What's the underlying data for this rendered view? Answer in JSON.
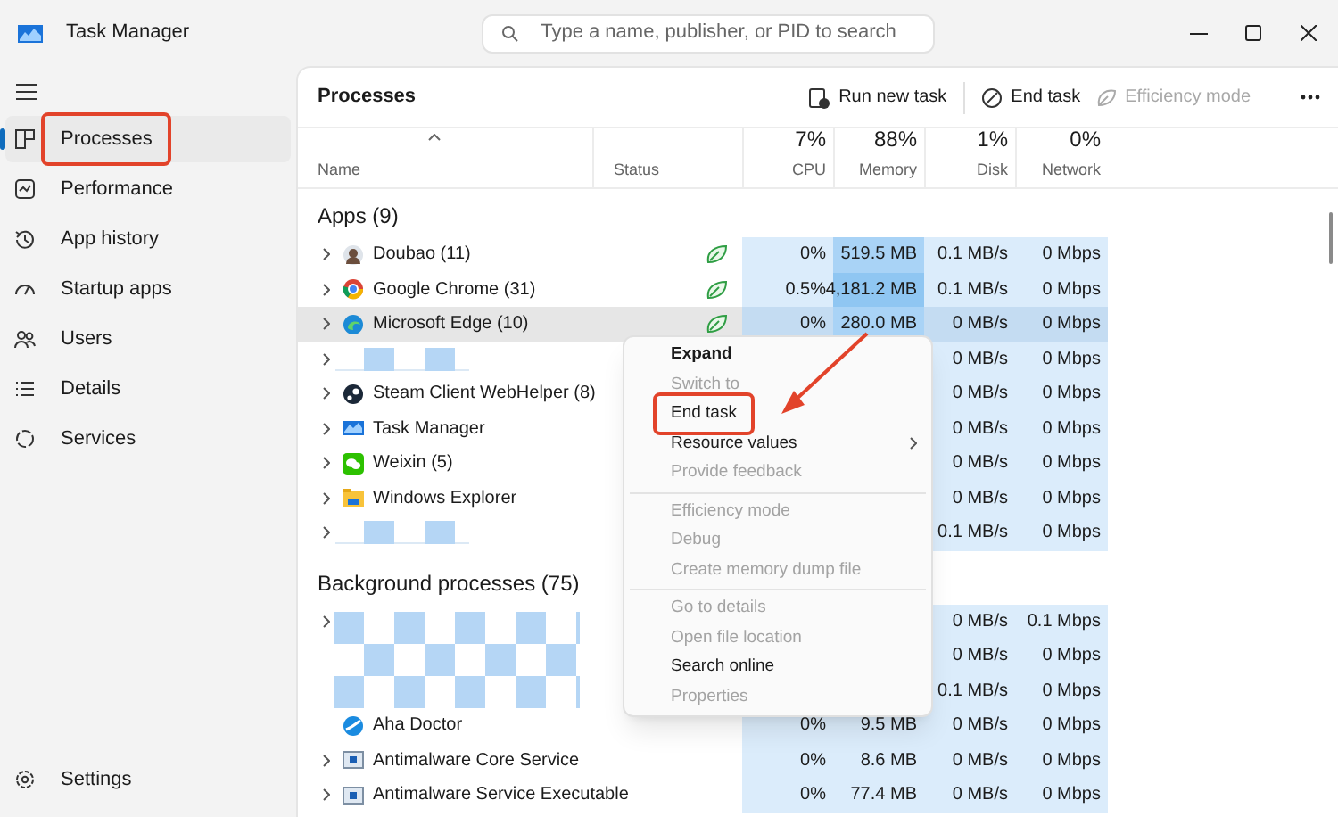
{
  "window": {
    "title": "Task Manager"
  },
  "search": {
    "placeholder": "Type a name, publisher, or PID to search"
  },
  "sidebar": {
    "items": [
      {
        "label": "Processes",
        "selected": true,
        "highlighted": true
      },
      {
        "label": "Performance",
        "selected": false,
        "highlighted": false
      },
      {
        "label": "App history",
        "selected": false,
        "highlighted": false
      },
      {
        "label": "Startup apps",
        "selected": false,
        "highlighted": false
      },
      {
        "label": "Users",
        "selected": false,
        "highlighted": false
      },
      {
        "label": "Details",
        "selected": false,
        "highlighted": false
      },
      {
        "label": "Services",
        "selected": false,
        "highlighted": false
      }
    ],
    "footer": {
      "label": "Settings"
    }
  },
  "page_title": "Processes",
  "toolbar": [
    {
      "label": "Run new task",
      "disabled": false
    },
    {
      "label": "End task",
      "disabled": false
    },
    {
      "label": "Efficiency mode",
      "disabled": true
    }
  ],
  "columns": [
    {
      "label": "Name"
    },
    {
      "label": "Status"
    },
    {
      "usage": "7%",
      "label": "CPU"
    },
    {
      "usage": "88%",
      "label": "Memory"
    },
    {
      "usage": "1%",
      "label": "Disk"
    },
    {
      "usage": "0%",
      "label": "Network"
    }
  ],
  "groups": [
    {
      "title": "Apps (9)",
      "rows": [
        {
          "kind": "app",
          "name": "Doubao (11)",
          "expandable": true,
          "efficiency": true,
          "hovered": false,
          "memory_hot": true,
          "cpu": "0%",
          "memory": "519.5 MB",
          "disk": "0.1 MB/s",
          "network": "0 Mbps"
        },
        {
          "kind": "app",
          "name": "Google Chrome (31)",
          "expandable": true,
          "efficiency": true,
          "hovered": false,
          "memory_hot": true,
          "cpu": "0.5%",
          "memory": "4,181.2 MB",
          "disk": "0.1 MB/s",
          "network": "0 Mbps"
        },
        {
          "kind": "app",
          "name": "Microsoft Edge (10)",
          "expandable": true,
          "efficiency": true,
          "hovered": true,
          "memory_hot": true,
          "cpu": "0%",
          "memory": "280.0 MB",
          "disk": "0 MB/s",
          "network": "0 Mbps"
        },
        {
          "kind": "redacted",
          "expandable": true,
          "efficiency": false,
          "hovered": false,
          "disk": "0 MB/s",
          "network": "0 Mbps"
        },
        {
          "kind": "app",
          "name": "Steam Client WebHelper (8)",
          "expandable": true,
          "efficiency": false,
          "hovered": false,
          "disk": "0 MB/s",
          "network": "0 Mbps"
        },
        {
          "kind": "app",
          "name": "Task Manager",
          "expandable": true,
          "efficiency": false,
          "hovered": false,
          "disk": "0 MB/s",
          "network": "0 Mbps"
        },
        {
          "kind": "app",
          "name": "Weixin (5)",
          "expandable": true,
          "efficiency": false,
          "hovered": false,
          "disk": "0 MB/s",
          "network": "0 Mbps"
        },
        {
          "kind": "app",
          "name": "Windows Explorer",
          "expandable": true,
          "efficiency": false,
          "hovered": false,
          "disk": "0 MB/s",
          "network": "0 Mbps"
        },
        {
          "kind": "redacted",
          "expandable": true,
          "efficiency": false,
          "hovered": false,
          "disk": "0.1 MB/s",
          "network": "0 Mbps"
        }
      ]
    },
    {
      "title": "Background processes (75)",
      "rows": [
        {
          "kind": "redacted",
          "expandable": true,
          "efficiency": false,
          "hovered": false,
          "disk": "0 MB/s",
          "network": "0.1 Mbps"
        },
        {
          "kind": "redacted",
          "expandable": false,
          "efficiency": false,
          "hovered": false,
          "disk": "0 MB/s",
          "network": "0 Mbps"
        },
        {
          "kind": "redacted",
          "expandable": false,
          "efficiency": false,
          "hovered": false,
          "disk": "0.1 MB/s",
          "network": "0 Mbps"
        },
        {
          "kind": "app",
          "name": "Aha Doctor",
          "expandable": false,
          "efficiency": false,
          "hovered": false,
          "memory_hot": false,
          "cpu": "0%",
          "memory": "9.5 MB",
          "disk": "0 MB/s",
          "network": "0 Mbps"
        },
        {
          "kind": "app",
          "name": "Antimalware Core Service",
          "expandable": true,
          "efficiency": false,
          "hovered": false,
          "memory_hot": false,
          "cpu": "0%",
          "memory": "8.6 MB",
          "disk": "0 MB/s",
          "network": "0 Mbps"
        },
        {
          "kind": "app",
          "name": "Antimalware Service Executable",
          "expandable": true,
          "efficiency": false,
          "hovered": false,
          "memory_hot": false,
          "cpu": "0%",
          "memory": "77.4 MB",
          "disk": "0 MB/s",
          "network": "0 Mbps"
        }
      ]
    }
  ],
  "context_menu": {
    "items": [
      {
        "kind": "item",
        "label": "Expand",
        "bold": true,
        "disabled": false,
        "submenu": false,
        "highlighted": false
      },
      {
        "kind": "item",
        "label": "Switch to",
        "bold": false,
        "disabled": true,
        "submenu": false,
        "highlighted": false
      },
      {
        "kind": "item",
        "label": "End task",
        "bold": false,
        "disabled": false,
        "submenu": false,
        "highlighted": true
      },
      {
        "kind": "item",
        "label": "Resource values",
        "bold": false,
        "disabled": false,
        "submenu": true,
        "highlighted": false
      },
      {
        "kind": "item",
        "label": "Provide feedback",
        "bold": false,
        "disabled": true,
        "submenu": false,
        "highlighted": false
      },
      {
        "kind": "separator"
      },
      {
        "kind": "item",
        "label": "Efficiency mode",
        "bold": false,
        "disabled": true,
        "submenu": false,
        "highlighted": false
      },
      {
        "kind": "item",
        "label": "Debug",
        "bold": false,
        "disabled": true,
        "submenu": false,
        "highlighted": false
      },
      {
        "kind": "item",
        "label": "Create memory dump file",
        "bold": false,
        "disabled": true,
        "submenu": false,
        "highlighted": false
      },
      {
        "kind": "separator"
      },
      {
        "kind": "item",
        "label": "Go to details",
        "bold": false,
        "disabled": true,
        "submenu": false,
        "highlighted": false
      },
      {
        "kind": "item",
        "label": "Open file location",
        "bold": false,
        "disabled": true,
        "submenu": false,
        "highlighted": false
      },
      {
        "kind": "item",
        "label": "Search online",
        "bold": false,
        "disabled": false,
        "submenu": false,
        "highlighted": false
      },
      {
        "kind": "item",
        "label": "Properties",
        "bold": false,
        "disabled": true,
        "submenu": false,
        "highlighted": false
      }
    ]
  }
}
